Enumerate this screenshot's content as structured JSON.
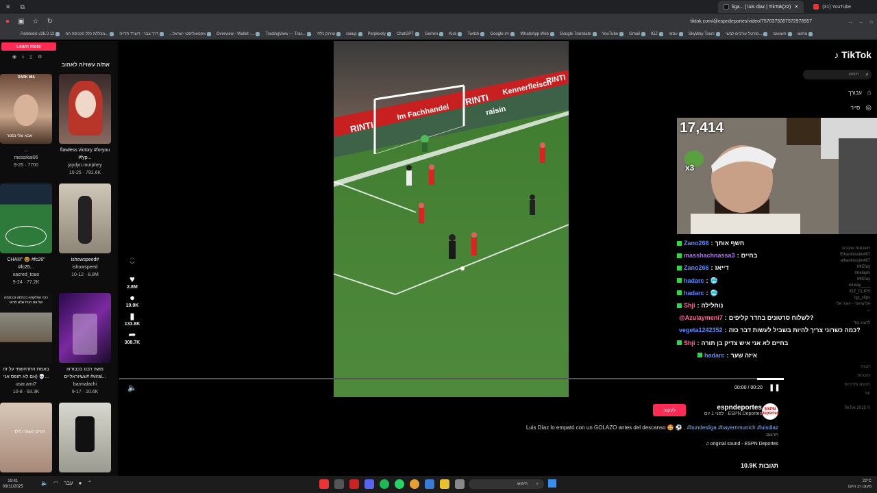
{
  "browser": {
    "tabs": [
      {
        "label": "liga... | luis diaz | TikTok(22)",
        "active": true
      },
      {
        "label": "(31) YouTube",
        "active": false
      }
    ],
    "url": "tiktok.com/@espndeportes/video/7570375087572978957",
    "bookmarks": [
      "Paletools v26.0.12",
      "מכללת כלל הכניסה הח...",
      "דרך צבר - דשרד חדייה",
      "...אקטואליסטי ישראל",
      "Overview - Wallet -...",
      "TradingView — Trac...",
      "שירוק כללי",
      "raeup",
      "Perplexity",
      "ChatGPT",
      "Gemini",
      "Kick",
      "Twitch",
      "Google יחו",
      "WhatsApp Web",
      "Google Translate",
      "YouTube",
      "Gmail",
      "IGZ",
      "עסמי",
      "SkyWay Tours",
      "פורטל עורבים לבשי...",
      "השוואם",
      "מחשנ"
    ]
  },
  "sidebar_left": {
    "learn_more": "Learn more",
    "header": "את/ה עשוי/ה לאהוב",
    "videos": [
      {
        "caption": "...",
        "user": "messikai06",
        "meta": "9-25 · 7700"
      },
      {
        "caption": "flawless victory #foryou #fyp...",
        "user": "jaydyn.murphey",
        "meta": "10-25 · 791.6K"
      },
      {
        "caption": "CHAIII\" 🤓 #fc26\" #fc25...",
        "user": "sacred_toao",
        "meta": "9-24 · 77.2K"
      },
      {
        "caption": "ishowspeed#",
        "user": "ishowspeed",
        "meta": "10-12 · 8.8M"
      },
      {
        "caption": "באמת התרחשתי על זה 💀 (אם לא תופס אני...",
        "user": "usar.ami7",
        "meta": "10-8 · 93.3K"
      },
      {
        "caption": "משה רבנו בכבודווו #עשיוראליים #viral...",
        "user": "barmalachi",
        "meta": "9-17 · 10.6K"
      }
    ],
    "thumb_texts": {
      "t1_label": "DARK MIA",
      "t1_caption": "אבא שלי נסטר",
      "t5_text": "ככה התלקחה בכתתה ובכתתה של את הניח שלא תראו",
      "t7_text": "הורים השמרו לילד"
    }
  },
  "video": {
    "stadium_words": [
      "RINTI",
      "Im Fachhandel",
      "RINTI",
      "Kennerfleisch",
      "raisin",
      "RINTI"
    ],
    "likes": "2.8M",
    "comments_count": "10.9K",
    "saves": "133.8K",
    "shares": "308.7K",
    "time": "00:00 / 00:20",
    "progress": 0.04
  },
  "author": {
    "follow_label": "לעקוב",
    "name": "espndeportes",
    "subtitle": "לפני 1 יום · ESPN Deportes",
    "avatar_text": "ESPN Deportes"
  },
  "post": {
    "caption_text": "Luis Díaz lo empató con un GOLAZO antes del descanso 🤩 ⚽ .",
    "caption_tags": "#bundesliga #bayernmunich #luisdiaz",
    "translate": "תרגום",
    "sound": "♫ original sound - ESPN Deportes",
    "comments_header": "10.9K תגובות"
  },
  "sidebar_right": {
    "logo": "TikTok",
    "search_placeholder": "חיפוש",
    "nav": [
      {
        "label": "עבורך",
        "icon": "home-icon"
      },
      {
        "label": "סייר",
        "icon": "compass-icon"
      }
    ],
    "suggested_header": "חשבונות עוקבים",
    "suggested": [
      "Elhaninissim467",
      "elhaninissim467",
      "MrEfay",
      "mrelaytv",
      "MrEfay",
      "mrelay____",
      "IGZ_CLIPS",
      "igz_clips",
      "אלישיוהר - יואיר אלי",
      "..."
    ],
    "show_more": "להציג עוד",
    "footer": [
      "חברה",
      "תוכניות",
      "תנאים ומדיניות",
      "עוד",
      "TikTok 2025 ©"
    ]
  },
  "stream_overlay": {
    "viewer_count": "17,414",
    "emote_text": "x3",
    "chat": [
      {
        "user": "Zano266",
        "text": "חשף אותך",
        "color": "#5b8cff"
      },
      {
        "user": "masshachnassa3",
        "text": "בחיים",
        "color": "#b36cff"
      },
      {
        "user": "Zano266",
        "text": "דייאז",
        "color": "#5b8cff"
      },
      {
        "user": "hadarc",
        "text": "🥶",
        "color": "#5b8cff"
      },
      {
        "user": "hadarc",
        "text": "🥶",
        "color": "#5b8cff"
      },
      {
        "user": "Shji",
        "text": "נוחלילה",
        "color": "#ff6b9a"
      },
      {
        "user": "@Azulaymeni7",
        "text": "לשלוח סרטונים בחדר קליפים?",
        "color": "#ff6b9a"
      },
      {
        "user": "vegeta1242352",
        "text": "כמה כשרוני צריך להיות בשביל לעשות דבר כזה?",
        "color": "#5b8cff"
      },
      {
        "user": "Shji",
        "text": "בחיים לא אני איש צדיק בן תורה",
        "color": "#ff6b9a"
      },
      {
        "user": "hadarc",
        "text": "איזה שער",
        "color": "#5b8cff"
      }
    ]
  },
  "taskbar": {
    "time": "19:41",
    "date": "09/11/2025",
    "lang": "עבר",
    "search_placeholder": "חיפוש",
    "weather_temp": "22°C",
    "weather_desc": "מעונן רב היום"
  },
  "colors": {
    "accent": "#fe2c55",
    "tag_blue": "#8cb6f5",
    "pitch": "#3b6b2d"
  }
}
